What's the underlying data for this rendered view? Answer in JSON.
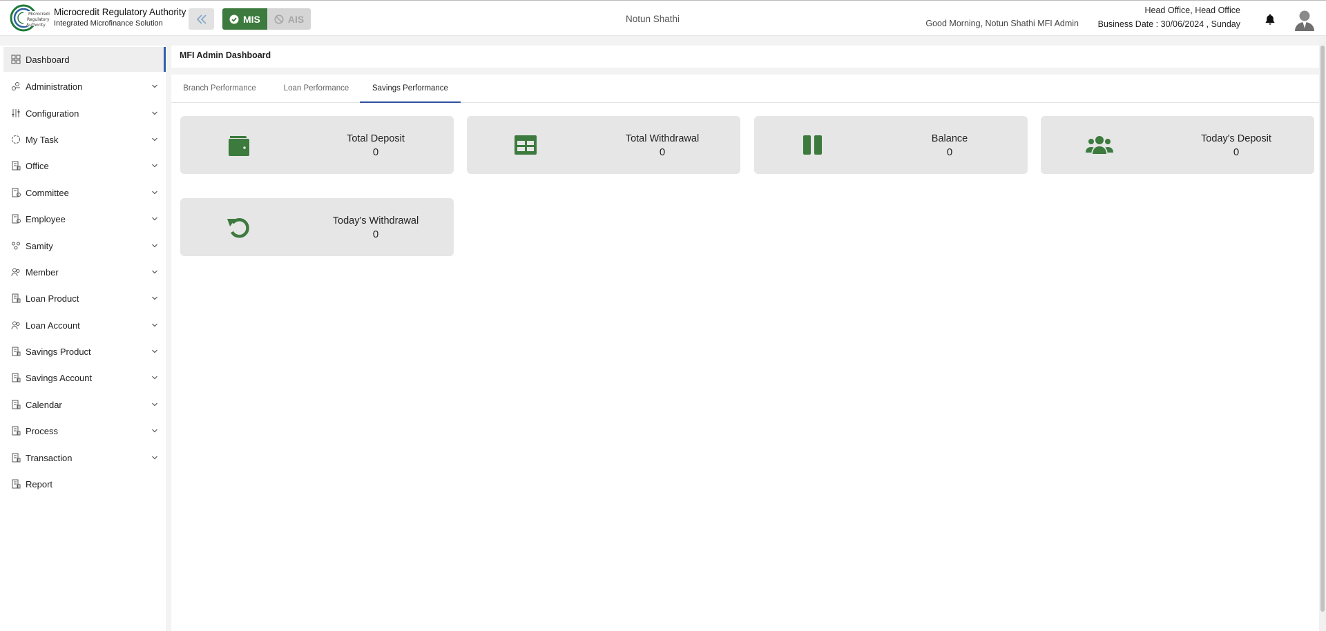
{
  "header": {
    "org_name": "Microcredit Regulatory Authority",
    "org_subtitle": "Integrated Microfinance Solution",
    "modes": [
      {
        "label": "MIS",
        "active": true
      },
      {
        "label": "AIS",
        "active": false
      }
    ],
    "center_title": "Notun Shathi",
    "greeting": "Good Morning, Notun Shathi MFI Admin",
    "office": "Head Office, Head Office",
    "business_date": "Business Date : 30/06/2024 , Sunday",
    "accent_color": "#3c7a3d"
  },
  "sidebar": {
    "items": [
      {
        "label": "Dashboard",
        "icon": "grid-icon",
        "active": true,
        "expandable": false
      },
      {
        "label": "Administration",
        "icon": "admin-icon",
        "active": false,
        "expandable": true
      },
      {
        "label": "Configuration",
        "icon": "sliders-icon",
        "active": false,
        "expandable": true
      },
      {
        "label": "My Task",
        "icon": "task-icon",
        "active": false,
        "expandable": true
      },
      {
        "label": "Office",
        "icon": "building-icon",
        "active": false,
        "expandable": true
      },
      {
        "label": "Committee",
        "icon": "committee-icon",
        "active": false,
        "expandable": true
      },
      {
        "label": "Employee",
        "icon": "employee-icon",
        "active": false,
        "expandable": true
      },
      {
        "label": "Samity",
        "icon": "group-icon",
        "active": false,
        "expandable": true
      },
      {
        "label": "Member",
        "icon": "users-icon",
        "active": false,
        "expandable": true
      },
      {
        "label": "Loan Product",
        "icon": "document-icon",
        "active": false,
        "expandable": true
      },
      {
        "label": "Loan Account",
        "icon": "users-icon",
        "active": false,
        "expandable": true
      },
      {
        "label": "Savings Product",
        "icon": "document-icon",
        "active": false,
        "expandable": true
      },
      {
        "label": "Savings Account",
        "icon": "document-icon",
        "active": false,
        "expandable": true
      },
      {
        "label": "Calendar",
        "icon": "document-icon",
        "active": false,
        "expandable": true
      },
      {
        "label": "Process",
        "icon": "document-icon",
        "active": false,
        "expandable": true
      },
      {
        "label": "Transaction",
        "icon": "document-icon",
        "active": false,
        "expandable": true
      },
      {
        "label": "Report",
        "icon": "document-icon",
        "active": false,
        "expandable": false
      }
    ]
  },
  "breadcrumb": "MFI Admin Dashboard",
  "tabs": [
    {
      "label": "Branch Performance",
      "active": false
    },
    {
      "label": "Loan Performance",
      "active": false
    },
    {
      "label": "Savings Performance",
      "active": true
    }
  ],
  "cards": [
    {
      "title": "Total Deposit",
      "value": "0",
      "icon": "wallet-icon"
    },
    {
      "title": "Total Withdrawal",
      "value": "0",
      "icon": "table-icon"
    },
    {
      "title": "Balance",
      "value": "0",
      "icon": "pause-icon"
    },
    {
      "title": "Today's Deposit",
      "value": "0",
      "icon": "users-group-icon"
    },
    {
      "title": "Today's Withdrawal",
      "value": "0",
      "icon": "undo-icon"
    }
  ]
}
